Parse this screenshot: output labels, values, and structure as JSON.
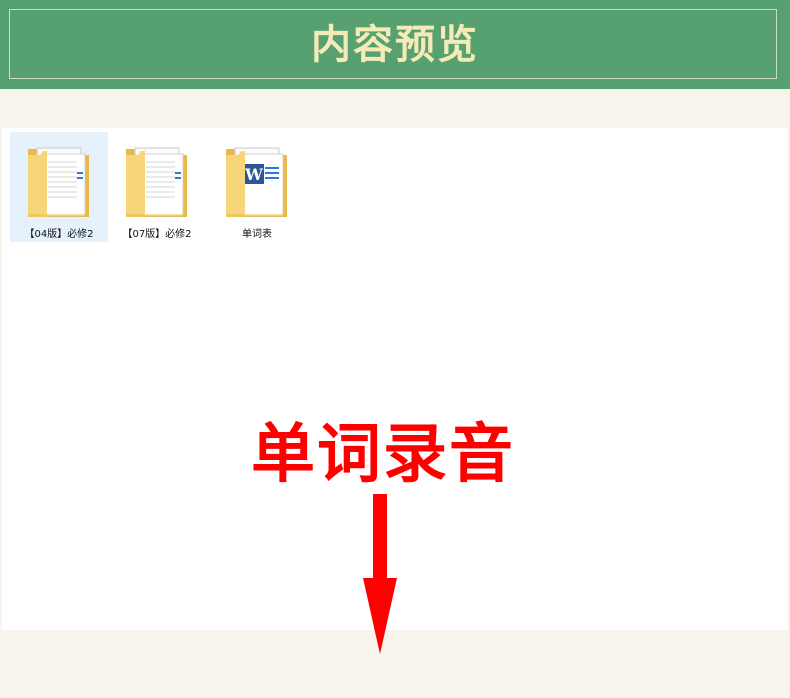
{
  "header": {
    "title": "内容预览"
  },
  "files": [
    {
      "label": "【04版】必修2",
      "type": "folder",
      "icon": "folder-icon",
      "selected": true
    },
    {
      "label": "【07版】必修2",
      "type": "folder",
      "icon": "folder-icon",
      "selected": false
    },
    {
      "label": "单词表",
      "type": "word-document",
      "icon": "word-document-icon",
      "selected": false
    }
  ],
  "overlay": {
    "text": "单词录音",
    "arrow_icon": "down-arrow-icon"
  },
  "colors": {
    "header_bg": "#57a06f",
    "header_text": "#f4ebb8",
    "page_bg": "#f7f4ec",
    "selection": "#e5f1fb",
    "overlay_red": "#ff0000",
    "folder_yellow": "#f7d67a",
    "word_blue": "#2b5797"
  }
}
